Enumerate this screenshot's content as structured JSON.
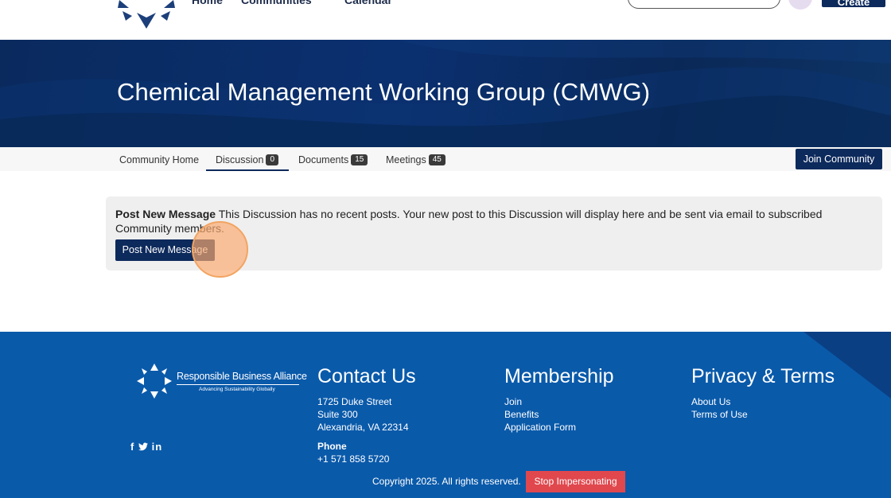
{
  "header": {
    "nav": [
      "Home",
      "Communities",
      "Calendar"
    ],
    "create_label": "Create"
  },
  "hero": {
    "title": "Chemical Management Working Group (CMWG)"
  },
  "tabs": [
    {
      "label": "Community Home",
      "count": null
    },
    {
      "label": "Discussion",
      "count": "0"
    },
    {
      "label": "Documents",
      "count": "15"
    },
    {
      "label": "Meetings",
      "count": "45"
    }
  ],
  "join_label": "Join Community",
  "post_panel": {
    "heading": "Post New Message",
    "message": " This Discussion has no recent posts. Your new post to this Discussion will display here and be sent via email to subscribed Community members.",
    "button_label": "Post New Message"
  },
  "footer": {
    "logo_name": "Responsible Business Alliance",
    "logo_tagline": "Advancing Sustainability Globally",
    "contact": {
      "title": "Contact Us",
      "address": [
        "1725 Duke Street",
        "Suite 300",
        "Alexandria, VA 22314"
      ],
      "phone_label": "Phone",
      "phone": "+1 571 858 5720"
    },
    "membership": {
      "title": "Membership",
      "links": [
        "Join",
        "Benefits",
        "Application Form"
      ]
    },
    "privacy": {
      "title": "Privacy & Terms",
      "links": [
        "About Us",
        "Terms of Use"
      ]
    },
    "social": [
      "f",
      "t",
      "in"
    ],
    "copyright": "Copyright 2025. All rights reserved.",
    "stop_label": "Stop Impersonating"
  },
  "colors": {
    "navy": "#0d2a5c",
    "footer_blue": "#0a5aaa",
    "stop_red": "#e0484e",
    "click_highlight": "#f2a462"
  }
}
